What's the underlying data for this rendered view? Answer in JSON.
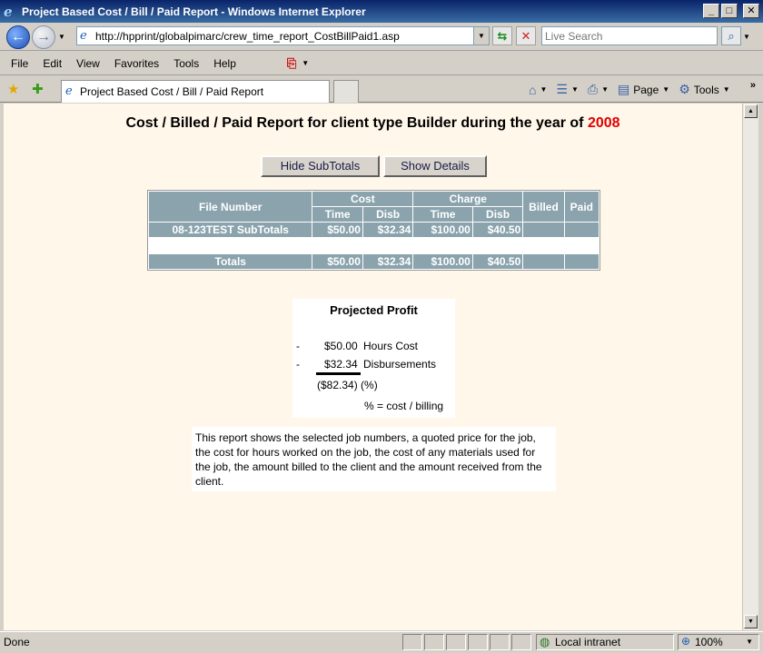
{
  "window": {
    "title": "Project Based Cost / Bill / Paid Report - Windows Internet Explorer",
    "min_glyph": "_",
    "max_glyph": "□",
    "close_glyph": "✕"
  },
  "nav": {
    "url": "http://hpprint/globalpimarc/crew_time_report_CostBillPaid1.asp",
    "search_placeholder": "Live Search"
  },
  "menu": {
    "items": [
      "File",
      "Edit",
      "View",
      "Favorites",
      "Tools",
      "Help"
    ]
  },
  "tabs": {
    "active_title": "Project Based Cost / Bill / Paid Report"
  },
  "command_bar": {
    "page_label": "Page",
    "tools_label": "Tools"
  },
  "report": {
    "title_prefix": "Cost / Billed / Paid Report for client type Builder during the year of",
    "year": "2008",
    "hide_subtotals_label": "Hide SubTotals",
    "show_details_label": "Show Details",
    "table": {
      "header": {
        "file_number": "File Number",
        "cost": "Cost",
        "charge": "Charge",
        "billed": "Billed",
        "paid": "Paid",
        "time": "Time",
        "disb": "Disb"
      },
      "subtotal_row": {
        "label": "08-123TEST SubTotals",
        "cost_time": "$50.00",
        "cost_disb": "$32.34",
        "charge_time": "$100.00",
        "charge_disb": "$40.50",
        "billed": "",
        "paid": ""
      },
      "totals_row": {
        "label": "Totals",
        "cost_time": "$50.00",
        "cost_disb": "$32.34",
        "charge_time": "$100.00",
        "charge_disb": "$40.50",
        "billed": "",
        "paid": ""
      }
    },
    "profit": {
      "title": "Projected Profit",
      "minus": "-",
      "hours_cost_value": "$50.00",
      "hours_cost_label": "Hours Cost",
      "disb_value": "$32.34",
      "disb_label": "Disbursements",
      "result": "($82.34) (%)",
      "formula": "% = cost / billing"
    },
    "description": "This report shows the selected job numbers, a quoted price for the job, the cost for hours worked on the job, the cost of any materials used for the job, the amount billed to the client and the amount received from the client."
  },
  "status": {
    "text": "Done",
    "zone": "Local intranet",
    "zoom": "100%"
  },
  "colors": {
    "page_bg": "#fff7ea",
    "table_header": "#8aa3ad",
    "year_accent": "#e00000"
  }
}
